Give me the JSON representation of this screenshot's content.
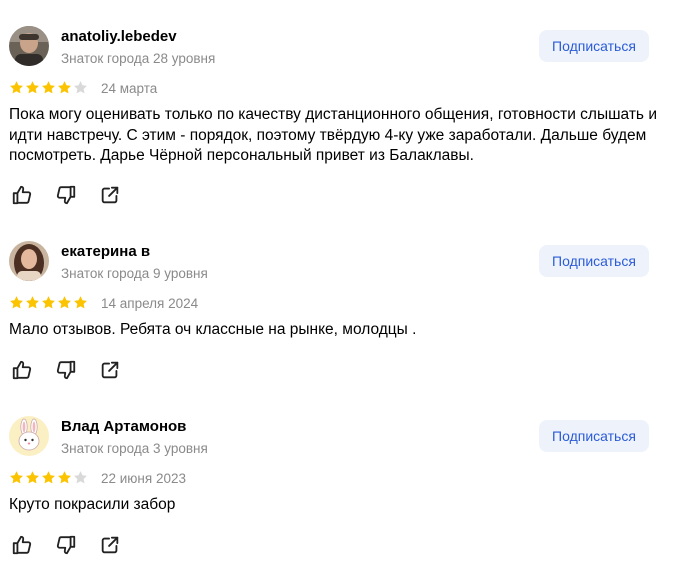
{
  "reviews": [
    {
      "author": "anatoliy.lebedev",
      "level": "Знаток города 28 уровня",
      "subscribe_label": "Подписаться",
      "rating": 4,
      "date": "24 марта",
      "text": "Пока могу оценивать только по качеству дистанционного общения, готовности слышать и идти навстречу. С этим - порядок, поэтому твёрдую 4-ку уже заработали. Дальше будем посмотреть. Дарье Чёрной персональный привет из Балаклавы."
    },
    {
      "author": "екатерина в",
      "level": "Знаток города 9 уровня",
      "subscribe_label": "Подписаться",
      "rating": 5,
      "date": "14 апреля 2024",
      "text": "Мало отзывов. Ребята оч классные на рынке, молодцы ."
    },
    {
      "author": "Влад Артамонов",
      "level": "Знаток города 3 уровня",
      "subscribe_label": "Подписаться",
      "rating": 4,
      "date": "22 июня 2023",
      "text": "Круто покрасили забор"
    }
  ],
  "colors": {
    "star_filled": "#fcc400",
    "star_empty": "#d9d9d9",
    "accent": "#2b5bd7",
    "muted": "#8a8a8a",
    "button_bg": "#eef3fb"
  },
  "icons": [
    "like-icon",
    "dislike-icon",
    "share-icon"
  ]
}
